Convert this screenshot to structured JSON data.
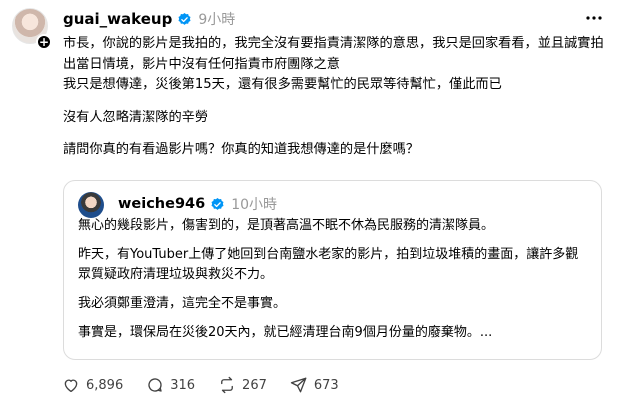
{
  "post": {
    "username": "guai_wakeup",
    "time": "9小時",
    "paragraphs": [
      "市長，你說的影片是我拍的，我完全沒有要指責清潔隊的意思，我只是回家看看，並且誠實拍出當日情境，影片中沒有任何指責市府團隊之意",
      "我只是想傳達，災後第15天，還有很多需要幫忙的民眾等待幫忙，僅此而已",
      "沒有人忽略清潔隊的辛勞",
      "請問你真的有看過影片嗎？你真的知道我想傳達的是什麼嗎？"
    ]
  },
  "quote": {
    "username": "weiche946",
    "time": "10小時",
    "paragraphs": [
      "無心的幾段影片，傷害到的，是頂著高溫不眠不休為民服務的清潔隊員。",
      "昨天，有YouTuber上傳了她回到台南鹽水老家的影片，拍到垃圾堆積的畫面，讓許多觀眾質疑政府清理垃圾與救災不力。",
      "我必須鄭重澄清，這完全不是事實。",
      "事實是，環保局在災後20天內，就已經清理台南9個月份量的廢棄物。..."
    ]
  },
  "actions": {
    "likes": "6,896",
    "comments": "316",
    "reposts": "267",
    "shares": "673"
  },
  "colors": {
    "verified": "#0095f6",
    "muted": "#999999",
    "border": "#dcdcdc"
  },
  "icons": [
    "heart-icon",
    "comment-icon",
    "repost-icon",
    "share-icon",
    "verified-badge-icon",
    "more-options-icon",
    "follow-plus-icon"
  ]
}
